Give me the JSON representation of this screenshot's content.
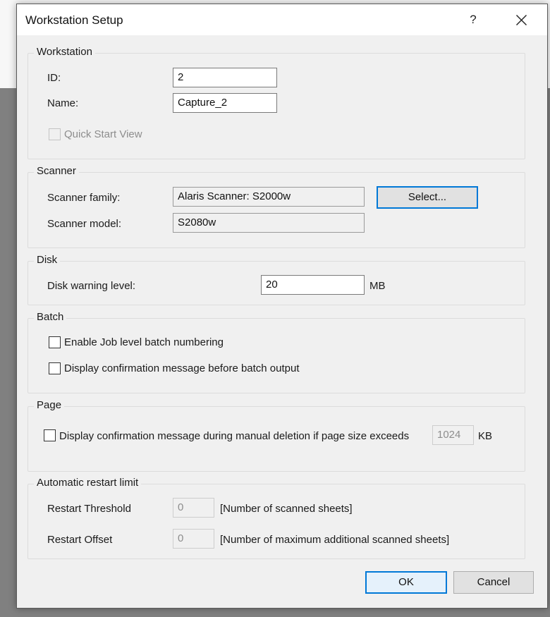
{
  "dialog": {
    "title": "Workstation Setup",
    "help_label": "?"
  },
  "workstation": {
    "group_label": "Workstation",
    "id_label": "ID:",
    "id_value": "2",
    "name_label": "Name:",
    "name_value": "Capture_2",
    "quick_start_label": "Quick Start View",
    "quick_start_checked": false
  },
  "scanner": {
    "group_label": "Scanner",
    "family_label": "Scanner family:",
    "family_value": "Alaris Scanner: S2000w",
    "model_label": "Scanner model:",
    "model_value": "S2080w",
    "select_label": "Select..."
  },
  "disk": {
    "group_label": "Disk",
    "warning_label": "Disk warning level:",
    "warning_value": "20",
    "unit": "MB"
  },
  "batch": {
    "group_label": "Batch",
    "job_numbering_label": "Enable Job level batch numbering",
    "job_numbering_checked": false,
    "confirm_output_label": "Display confirmation message before batch output",
    "confirm_output_checked": false
  },
  "page": {
    "group_label": "Page",
    "confirm_delete_label": "Display confirmation message during manual deletion if page size exceeds",
    "confirm_delete_checked": false,
    "size_value": "1024",
    "size_unit": "KB"
  },
  "restart": {
    "group_label": "Automatic restart limit",
    "threshold_label": "Restart Threshold",
    "threshold_value": "0",
    "threshold_hint": "[Number of scanned sheets]",
    "offset_label": "Restart Offset",
    "offset_value": "0",
    "offset_hint": "[Number of maximum additional scanned sheets]"
  },
  "buttons": {
    "ok_label": "OK",
    "cancel_label": "Cancel"
  }
}
